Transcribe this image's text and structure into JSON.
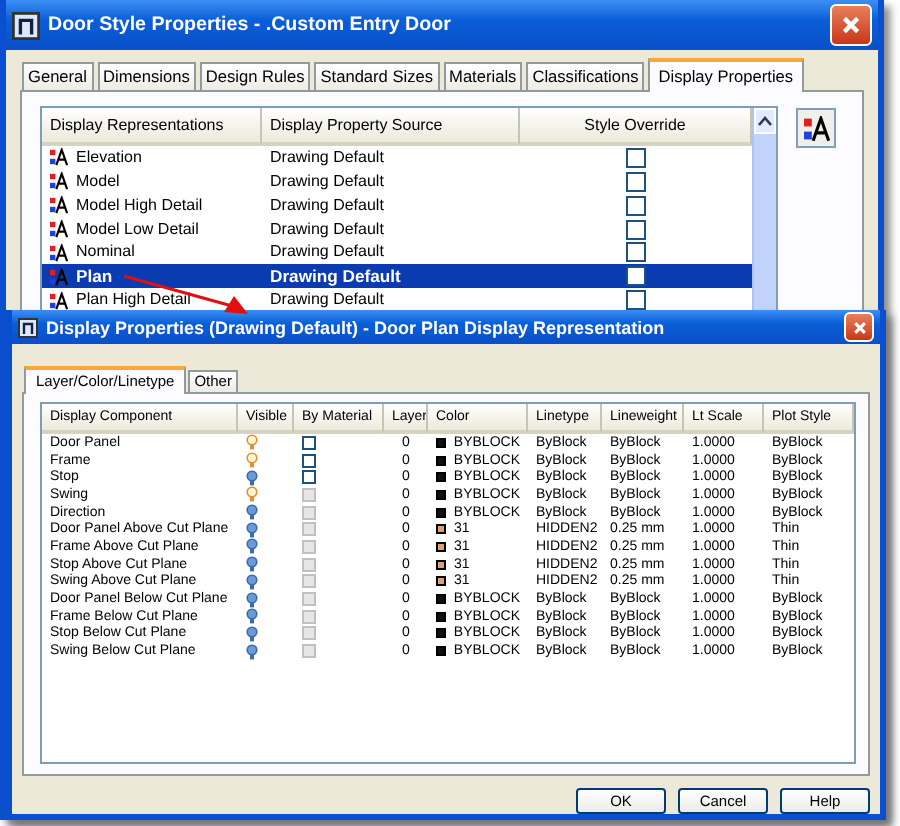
{
  "window": {
    "title": "Door Style Properties - .Custom Entry Door"
  },
  "tabs": [
    {
      "label": "General",
      "selected": false
    },
    {
      "label": "Dimensions",
      "selected": false
    },
    {
      "label": "Design Rules",
      "selected": false
    },
    {
      "label": "Standard Sizes",
      "selected": false
    },
    {
      "label": "Materials",
      "selected": false
    },
    {
      "label": "Classifications",
      "selected": false
    },
    {
      "label": "Display Properties",
      "selected": true
    }
  ],
  "representations": {
    "columns": [
      "Display Representations",
      "Display Property Source",
      "Style Override"
    ],
    "rows": [
      {
        "name": "Elevation",
        "source": "Drawing Default",
        "override": false,
        "selected": false
      },
      {
        "name": "Model",
        "source": "Drawing Default",
        "override": false,
        "selected": false
      },
      {
        "name": "Model High Detail",
        "source": "Drawing Default",
        "override": false,
        "selected": false
      },
      {
        "name": "Model Low Detail",
        "source": "Drawing Default",
        "override": false,
        "selected": false
      },
      {
        "name": "Nominal",
        "source": "Drawing Default",
        "override": false,
        "selected": false
      },
      {
        "name": "Plan",
        "source": "Drawing Default",
        "override": false,
        "selected": true
      },
      {
        "name": "Plan High Detail",
        "source": "Drawing Default",
        "override": false,
        "selected": false
      }
    ]
  },
  "dialog": {
    "title": "Display Properties (Drawing Default) - Door Plan Display Representation",
    "tabs": [
      {
        "label": "Layer/Color/Linetype",
        "selected": true
      },
      {
        "label": "Other",
        "selected": false
      }
    ],
    "columns": [
      "Display Component",
      "Visible",
      "By Material",
      "Layer",
      "Color",
      "Linetype",
      "Lineweight",
      "Lt Scale",
      "Plot Style"
    ],
    "rows": [
      {
        "component": "Door Panel",
        "visible": true,
        "disabled": false,
        "layer": "0",
        "color": "#111111",
        "color_name": "BYBLOCK",
        "linetype": "ByBlock",
        "lineweight": "ByBlock",
        "lt_scale": "1.0000",
        "plot_style": "ByBlock"
      },
      {
        "component": "Frame",
        "visible": true,
        "disabled": false,
        "layer": "0",
        "color": "#111111",
        "color_name": "BYBLOCK",
        "linetype": "ByBlock",
        "lineweight": "ByBlock",
        "lt_scale": "1.0000",
        "plot_style": "ByBlock"
      },
      {
        "component": "Stop",
        "visible": false,
        "disabled": false,
        "layer": "0",
        "color": "#111111",
        "color_name": "BYBLOCK",
        "linetype": "ByBlock",
        "lineweight": "ByBlock",
        "lt_scale": "1.0000",
        "plot_style": "ByBlock"
      },
      {
        "component": "Swing",
        "visible": true,
        "disabled": true,
        "layer": "0",
        "color": "#111111",
        "color_name": "BYBLOCK",
        "linetype": "ByBlock",
        "lineweight": "ByBlock",
        "lt_scale": "1.0000",
        "plot_style": "ByBlock"
      },
      {
        "component": "Direction",
        "visible": false,
        "disabled": true,
        "layer": "0",
        "color": "#111111",
        "color_name": "BYBLOCK",
        "linetype": "ByBlock",
        "lineweight": "ByBlock",
        "lt_scale": "1.0000",
        "plot_style": "ByBlock"
      },
      {
        "component": "Door Panel Above Cut Plane",
        "visible": false,
        "disabled": true,
        "layer": "0",
        "color": "#e0a070",
        "color_name": "31",
        "linetype": "HIDDEN2",
        "lineweight": "0.25 mm",
        "lt_scale": "1.0000",
        "plot_style": "Thin"
      },
      {
        "component": "Frame Above Cut Plane",
        "visible": false,
        "disabled": true,
        "layer": "0",
        "color": "#e0a070",
        "color_name": "31",
        "linetype": "HIDDEN2",
        "lineweight": "0.25 mm",
        "lt_scale": "1.0000",
        "plot_style": "Thin"
      },
      {
        "component": "Stop Above Cut Plane",
        "visible": false,
        "disabled": true,
        "layer": "0",
        "color": "#e0a070",
        "color_name": "31",
        "linetype": "HIDDEN2",
        "lineweight": "0.25 mm",
        "lt_scale": "1.0000",
        "plot_style": "Thin"
      },
      {
        "component": "Swing Above Cut Plane",
        "visible": false,
        "disabled": true,
        "layer": "0",
        "color": "#e0a070",
        "color_name": "31",
        "linetype": "HIDDEN2",
        "lineweight": "0.25 mm",
        "lt_scale": "1.0000",
        "plot_style": "Thin"
      },
      {
        "component": "Door Panel Below Cut Plane",
        "visible": false,
        "disabled": true,
        "layer": "0",
        "color": "#111111",
        "color_name": "BYBLOCK",
        "linetype": "ByBlock",
        "lineweight": "ByBlock",
        "lt_scale": "1.0000",
        "plot_style": "ByBlock"
      },
      {
        "component": "Frame Below Cut Plane",
        "visible": false,
        "disabled": true,
        "layer": "0",
        "color": "#111111",
        "color_name": "BYBLOCK",
        "linetype": "ByBlock",
        "lineweight": "ByBlock",
        "lt_scale": "1.0000",
        "plot_style": "ByBlock"
      },
      {
        "component": "Stop Below Cut Plane",
        "visible": false,
        "disabled": true,
        "layer": "0",
        "color": "#111111",
        "color_name": "BYBLOCK",
        "linetype": "ByBlock",
        "lineweight": "ByBlock",
        "lt_scale": "1.0000",
        "plot_style": "ByBlock"
      },
      {
        "component": "Swing Below Cut Plane",
        "visible": false,
        "disabled": true,
        "layer": "0",
        "color": "#111111",
        "color_name": "BYBLOCK",
        "linetype": "ByBlock",
        "lineweight": "ByBlock",
        "lt_scale": "1.0000",
        "plot_style": "ByBlock"
      }
    ],
    "buttons": [
      "OK",
      "Cancel",
      "Help"
    ]
  }
}
